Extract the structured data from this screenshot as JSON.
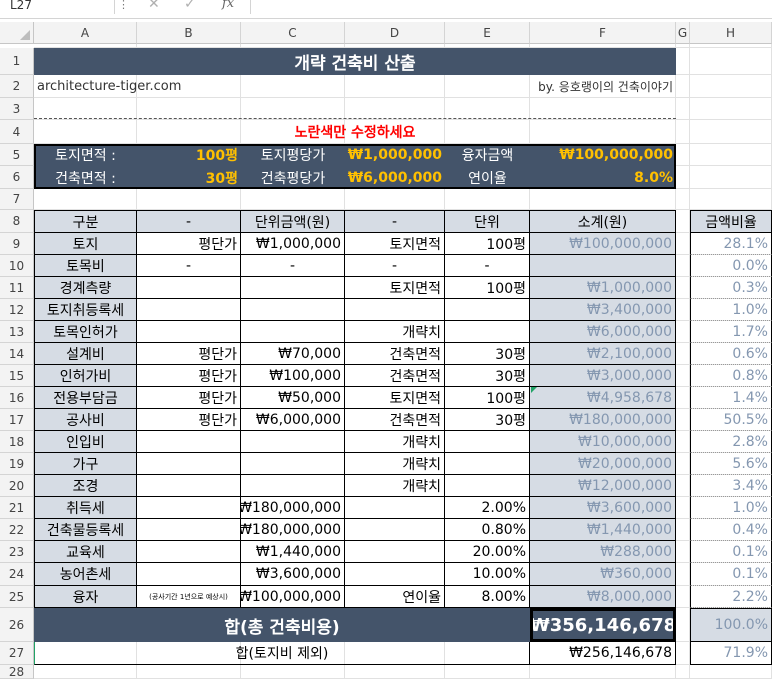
{
  "formula_bar": {
    "name_box": "L27",
    "sep": "⋮",
    "fx": "fx",
    "cancel_icon": "✕",
    "enter_icon": "✓"
  },
  "columns": [
    "A",
    "B",
    "C",
    "D",
    "E",
    "F",
    "G",
    "H"
  ],
  "rows": [
    "1",
    "2",
    "3",
    "4",
    "5",
    "6",
    "7",
    "8",
    "9",
    "10",
    "11",
    "12",
    "13",
    "14",
    "15",
    "16",
    "17",
    "18",
    "19",
    "20",
    "21",
    "22",
    "23",
    "24",
    "25",
    "26",
    "27",
    "28"
  ],
  "title": "개략 건축비 산출",
  "site": "architecture-tiger.com",
  "byline": "by. 응호랭이의 건축이야기",
  "notice": "노란색만 수정하세요",
  "inputs": {
    "land_area_label": "토지면적 :",
    "land_area": "100평",
    "land_price_label": "토지평당가",
    "land_price": "₩1,000,000",
    "loan_label": "융자금액",
    "loan": "₩100,000,000",
    "build_area_label": "건축면적 :",
    "build_area": "30평",
    "build_price_label": "건축평당가",
    "build_price": "₩6,000,000",
    "rate_label": "연이율",
    "rate": "8.0%"
  },
  "table": {
    "headers": [
      "구분",
      "-",
      "단위금액(원)",
      "-",
      "단위",
      "소계(원)"
    ],
    "ratio_header": "금액비율",
    "rows": [
      [
        "토지",
        "평단가",
        "₩1,000,000",
        "토지면적",
        "100평",
        "₩100,000,000",
        "28.1%"
      ],
      [
        "토목비",
        "-",
        "-",
        "-",
        "-",
        "",
        "0.0%"
      ],
      [
        "경계측량",
        "",
        "",
        "토지면적",
        "100평",
        "₩1,000,000",
        "0.3%"
      ],
      [
        "토지취등록세",
        "",
        "",
        "",
        "",
        "₩3,400,000",
        "1.0%"
      ],
      [
        "토목인허가",
        "",
        "",
        "개략치",
        "",
        "₩6,000,000",
        "1.7%"
      ],
      [
        "설계비",
        "평단가",
        "₩70,000",
        "건축면적",
        "30평",
        "₩2,100,000",
        "0.6%"
      ],
      [
        "인허가비",
        "평단가",
        "₩100,000",
        "건축면적",
        "30평",
        "₩3,000,000",
        "0.8%"
      ],
      [
        "전용부담금",
        "평단가",
        "₩50,000",
        "토지면적",
        "100평",
        "₩4,958,678",
        "1.4%"
      ],
      [
        "공사비",
        "평단가",
        "₩6,000,000",
        "건축면적",
        "30평",
        "₩180,000,000",
        "50.5%"
      ],
      [
        "인입비",
        "",
        "",
        "개략치",
        "",
        "₩10,000,000",
        "2.8%"
      ],
      [
        "가구",
        "",
        "",
        "개략치",
        "",
        "₩20,000,000",
        "5.6%"
      ],
      [
        "조경",
        "",
        "",
        "개략치",
        "",
        "₩12,000,000",
        "3.4%"
      ],
      [
        "취득세",
        "",
        "₩180,000,000",
        "",
        "2.00%",
        "₩3,600,000",
        "1.0%"
      ],
      [
        "건축물등록세",
        "",
        "₩180,000,000",
        "",
        "0.80%",
        "₩1,440,000",
        "0.4%"
      ],
      [
        "교육세",
        "",
        "₩1,440,000",
        "",
        "20.00%",
        "₩288,000",
        "0.1%"
      ],
      [
        "농어촌세",
        "",
        "₩3,600,000",
        "",
        "10.00%",
        "₩360,000",
        "0.1%"
      ],
      [
        "융자",
        "(공사기간 1년으로 예상시)",
        "₩100,000,000",
        "연이율",
        "8.00%",
        "₩8,000,000",
        "2.2%"
      ]
    ]
  },
  "total": {
    "label": "합(총 건축비용)",
    "value": "₩356,146,678",
    "ratio": "100.0%"
  },
  "excl": {
    "label": "합(토지비 제외)",
    "value": "₩256,146,678",
    "ratio": "71.9%"
  },
  "colors": {
    "header_dark": "#44546a",
    "header_light": "#d6dce4",
    "input_yellow": "#ffc000",
    "notice_red": "#ff0000"
  }
}
